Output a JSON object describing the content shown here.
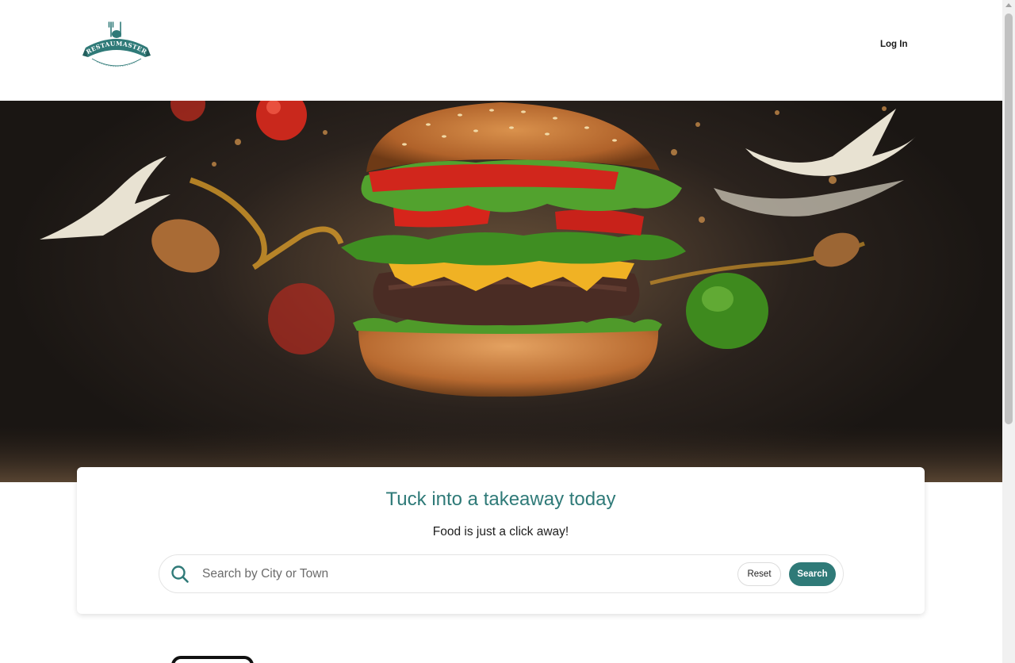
{
  "header": {
    "logo": {
      "name": "RESTAUMASTER",
      "icon": "fork-knife-icon",
      "color": "#2f7a78"
    },
    "login_label": "Log In"
  },
  "hero": {
    "image": "flying-burger-photo"
  },
  "search_card": {
    "title": "Tuck into a takeaway today",
    "subtitle": "Food is just a click away!",
    "search": {
      "placeholder": "Search by City or Town",
      "value": "",
      "icon": "search-icon"
    },
    "reset_label": "Reset",
    "search_label": "Search",
    "accent_color": "#2f7a78"
  }
}
